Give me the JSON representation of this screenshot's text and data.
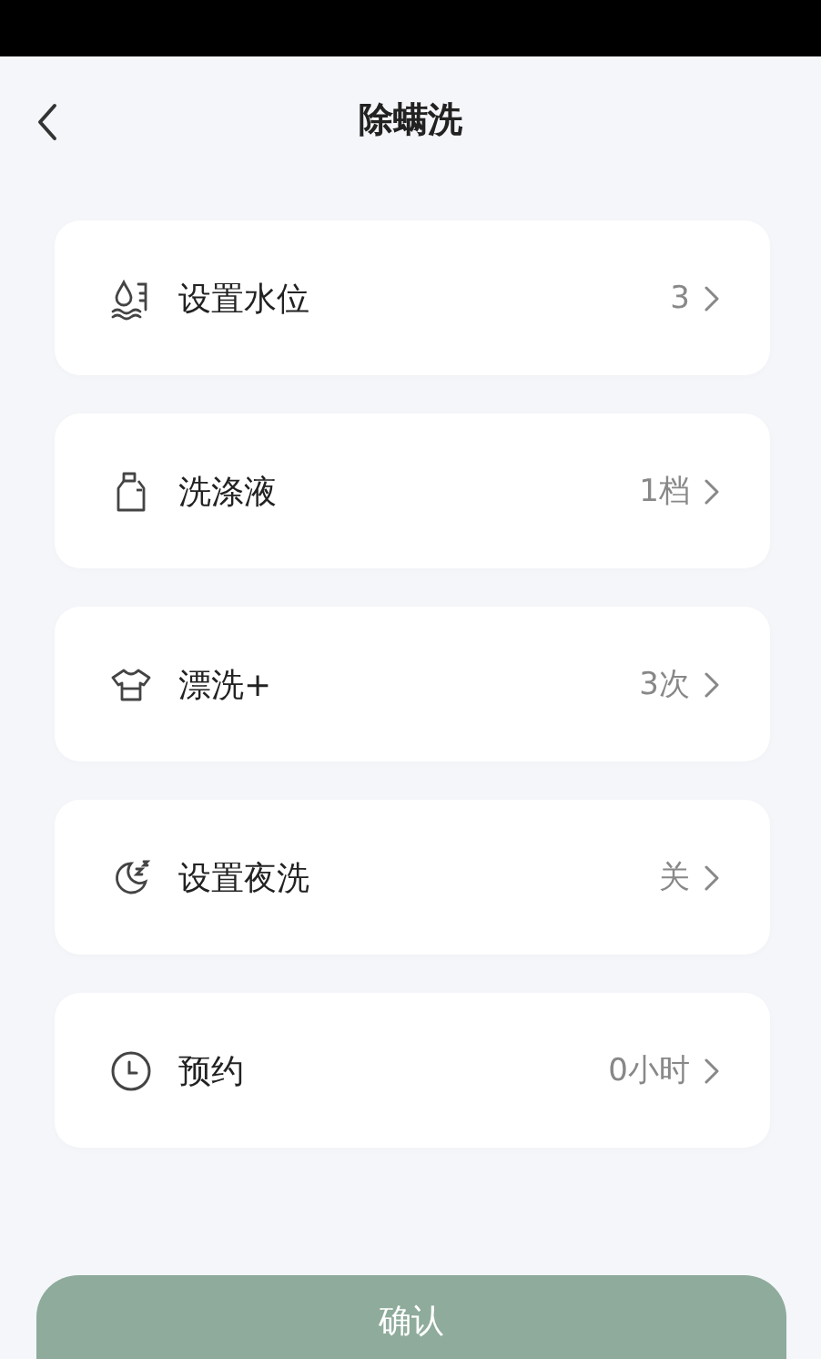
{
  "header": {
    "title": "除螨洗"
  },
  "settings": [
    {
      "kind": "water",
      "label": "设置水位",
      "value": "3"
    },
    {
      "kind": "detergent",
      "label": "洗涤液",
      "value": "1档"
    },
    {
      "kind": "rinse",
      "label": "漂洗+",
      "value": "3次"
    },
    {
      "kind": "night",
      "label": "设置夜洗",
      "value": "关"
    },
    {
      "kind": "schedule",
      "label": "预约",
      "value": "0小时"
    }
  ],
  "confirm_button": "确认"
}
